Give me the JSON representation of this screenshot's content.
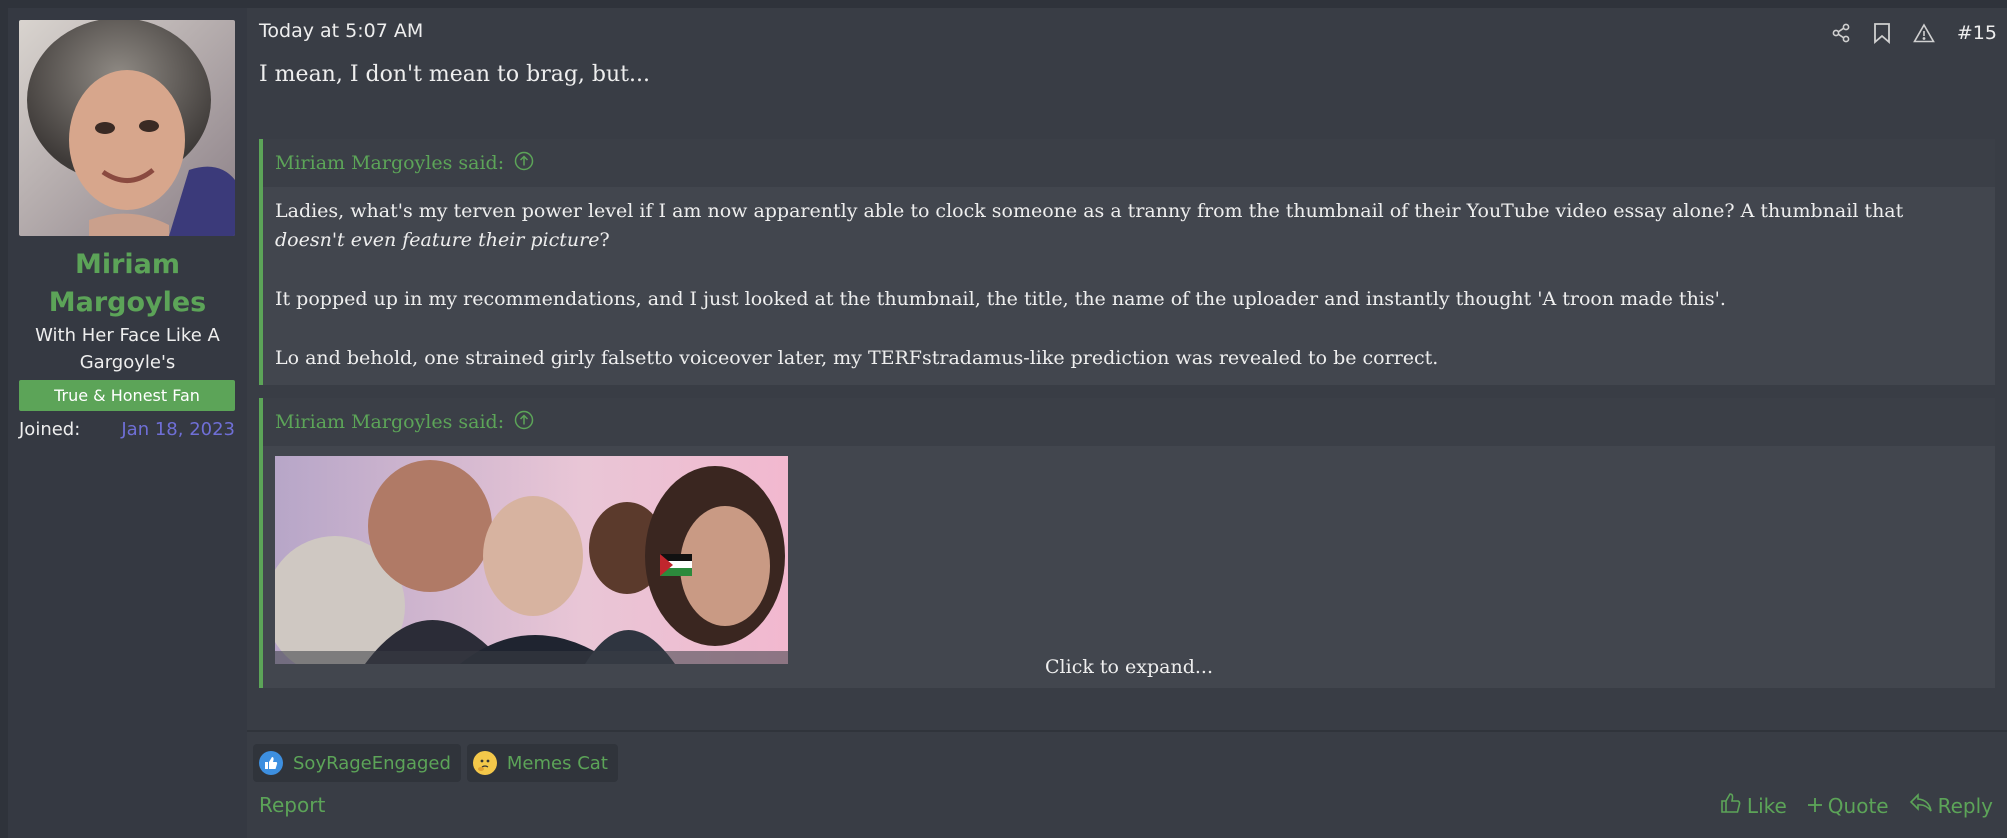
{
  "user": {
    "name": "Miriam Margoyles",
    "title": "With Her Face Like A Gargoyle's",
    "banner": "True & Honest Fan",
    "joined_label": "Joined:",
    "joined_value": "Jan 18, 2023"
  },
  "post": {
    "date": "Today at 5:07 AM",
    "number": "#15",
    "message": "I mean, I don't mean to brag, but..."
  },
  "header_icons": [
    "share-icon",
    "bookmark-icon",
    "warning-icon"
  ],
  "quotes": [
    {
      "attribution": "Miriam Margoyles said:",
      "p1_a": "Ladies, what's my terven power level if I am now apparently able to clock someone as a tranny from the thumbnail of their YouTube video essay alone? A thumbnail that ",
      "p1_em": "doesn't even feature their picture",
      "p1_b": "?",
      "p2": "It popped up in my recommendations, and I just looked at the thumbnail, the title, the name of the uploader and instantly thought 'A troon made this'.",
      "p3": "Lo and behold, one strained girly falsetto voiceover later, my TERFstradamus-like prediction was revealed to be correct."
    },
    {
      "attribution": "Miriam Margoyles said:",
      "expand": "Click to expand..."
    }
  ],
  "reactions": [
    {
      "label": "SoyRageEngaged",
      "icon": "thumbs-up-icon"
    },
    {
      "label": "Memes Cat",
      "icon": "thinking-face-icon"
    }
  ],
  "footer": {
    "report": "Report",
    "like": "Like",
    "quote": "Quote",
    "reply": "Reply"
  },
  "colors": {
    "accent": "#5ca458",
    "link_blue": "#6f6fd6",
    "background": "#393d45"
  }
}
